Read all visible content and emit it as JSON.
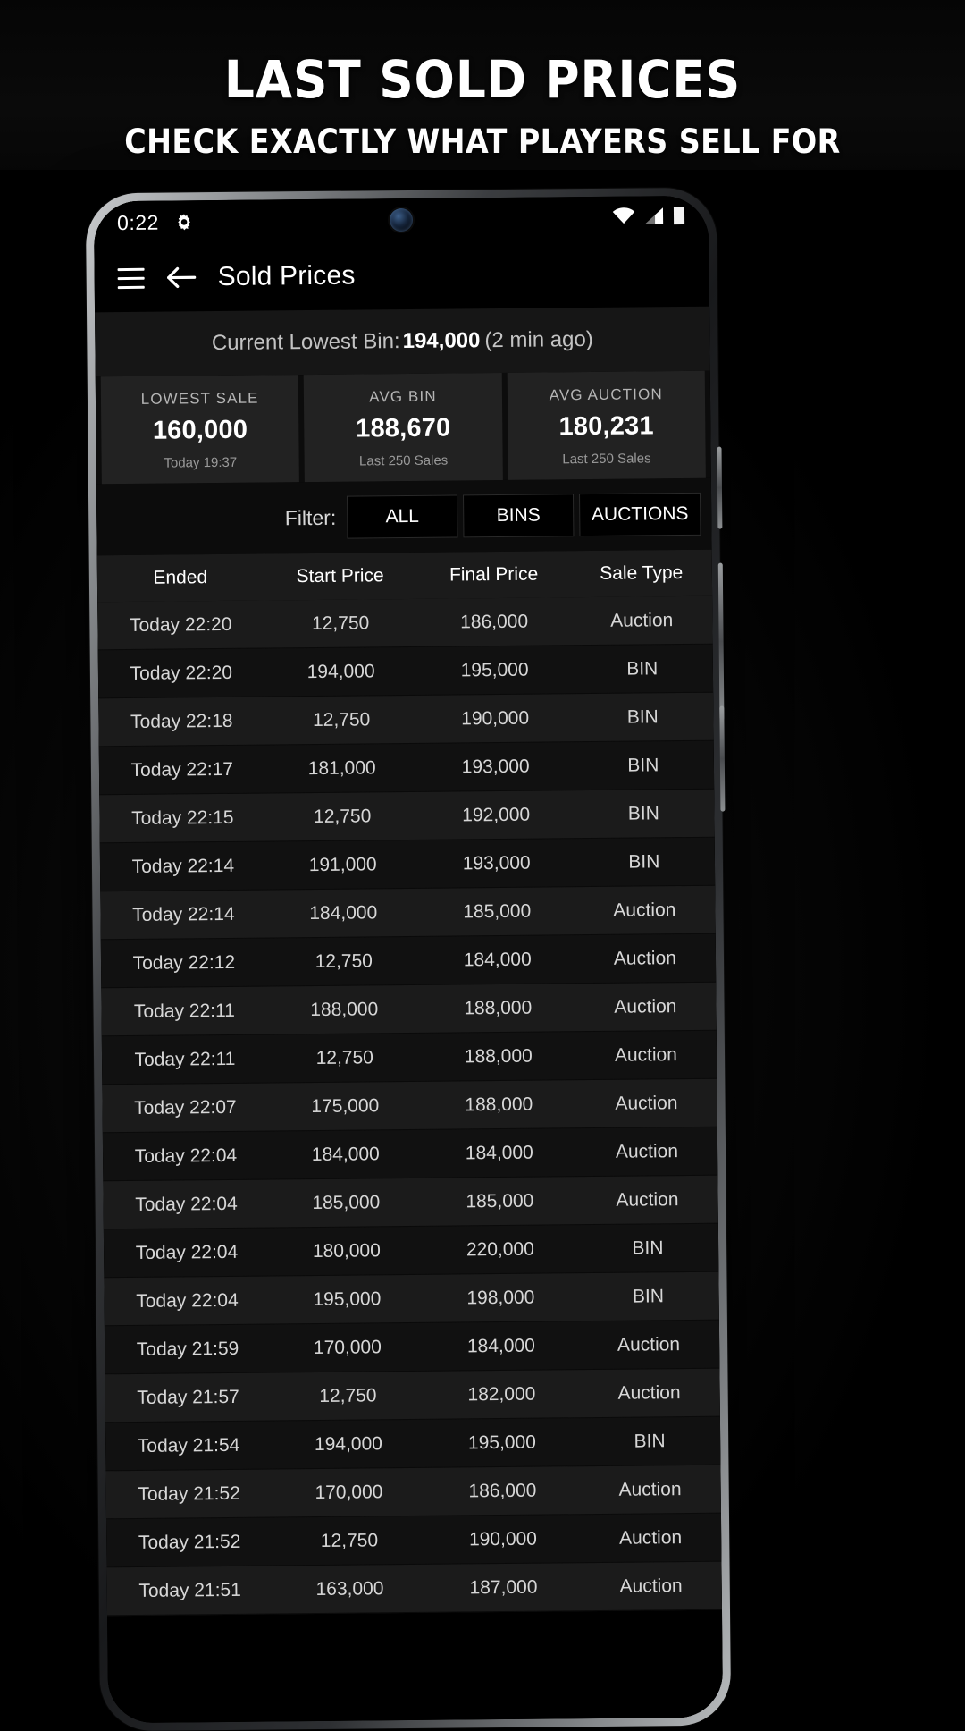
{
  "promo": {
    "title": "LAST SOLD PRICES",
    "subtitle": "CHECK EXACTLY WHAT PLAYERS SELL FOR"
  },
  "status_bar": {
    "time": "0:22",
    "gear_icon": "gear-icon",
    "wifi_icon": "wifi-icon",
    "signal_icon": "cellular-signal-icon",
    "battery_icon": "battery-icon"
  },
  "toolbar": {
    "menu_icon": "hamburger-menu-icon",
    "back_icon": "back-arrow-icon",
    "title": "Sold Prices"
  },
  "lowest_bin": {
    "label": "Current Lowest Bin:",
    "value": "194,000",
    "ago": "(2 min ago)"
  },
  "stats": [
    {
      "label": "LOWEST SALE",
      "value": "160,000",
      "sub": "Today 19:37"
    },
    {
      "label": "AVG BIN",
      "value": "188,670",
      "sub": "Last 250 Sales"
    },
    {
      "label": "AVG AUCTION",
      "value": "180,231",
      "sub": "Last 250 Sales"
    }
  ],
  "filter": {
    "label": "Filter:",
    "options": [
      "ALL",
      "BINS",
      "AUCTIONS"
    ],
    "selected": "ALL"
  },
  "table": {
    "headers": [
      "Ended",
      "Start Price",
      "Final Price",
      "Sale Type"
    ],
    "rows": [
      [
        "Today 22:20",
        "12,750",
        "186,000",
        "Auction"
      ],
      [
        "Today 22:20",
        "194,000",
        "195,000",
        "BIN"
      ],
      [
        "Today 22:18",
        "12,750",
        "190,000",
        "BIN"
      ],
      [
        "Today 22:17",
        "181,000",
        "193,000",
        "BIN"
      ],
      [
        "Today 22:15",
        "12,750",
        "192,000",
        "BIN"
      ],
      [
        "Today 22:14",
        "191,000",
        "193,000",
        "BIN"
      ],
      [
        "Today 22:14",
        "184,000",
        "185,000",
        "Auction"
      ],
      [
        "Today 22:12",
        "12,750",
        "184,000",
        "Auction"
      ],
      [
        "Today 22:11",
        "188,000",
        "188,000",
        "Auction"
      ],
      [
        "Today 22:11",
        "12,750",
        "188,000",
        "Auction"
      ],
      [
        "Today 22:07",
        "175,000",
        "188,000",
        "Auction"
      ],
      [
        "Today 22:04",
        "184,000",
        "184,000",
        "Auction"
      ],
      [
        "Today 22:04",
        "185,000",
        "185,000",
        "Auction"
      ],
      [
        "Today 22:04",
        "180,000",
        "220,000",
        "BIN"
      ],
      [
        "Today 22:04",
        "195,000",
        "198,000",
        "BIN"
      ],
      [
        "Today 21:59",
        "170,000",
        "184,000",
        "Auction"
      ],
      [
        "Today 21:57",
        "12,750",
        "182,000",
        "Auction"
      ],
      [
        "Today 21:54",
        "194,000",
        "195,000",
        "BIN"
      ],
      [
        "Today 21:52",
        "170,000",
        "186,000",
        "Auction"
      ],
      [
        "Today 21:52",
        "12,750",
        "190,000",
        "Auction"
      ],
      [
        "Today 21:51",
        "163,000",
        "187,000",
        "Auction"
      ]
    ]
  },
  "colors": {
    "background": "#000000",
    "card": "#222222",
    "row_odd": "#1b1b1b",
    "row_even": "#111111",
    "text": "#ffffff"
  }
}
